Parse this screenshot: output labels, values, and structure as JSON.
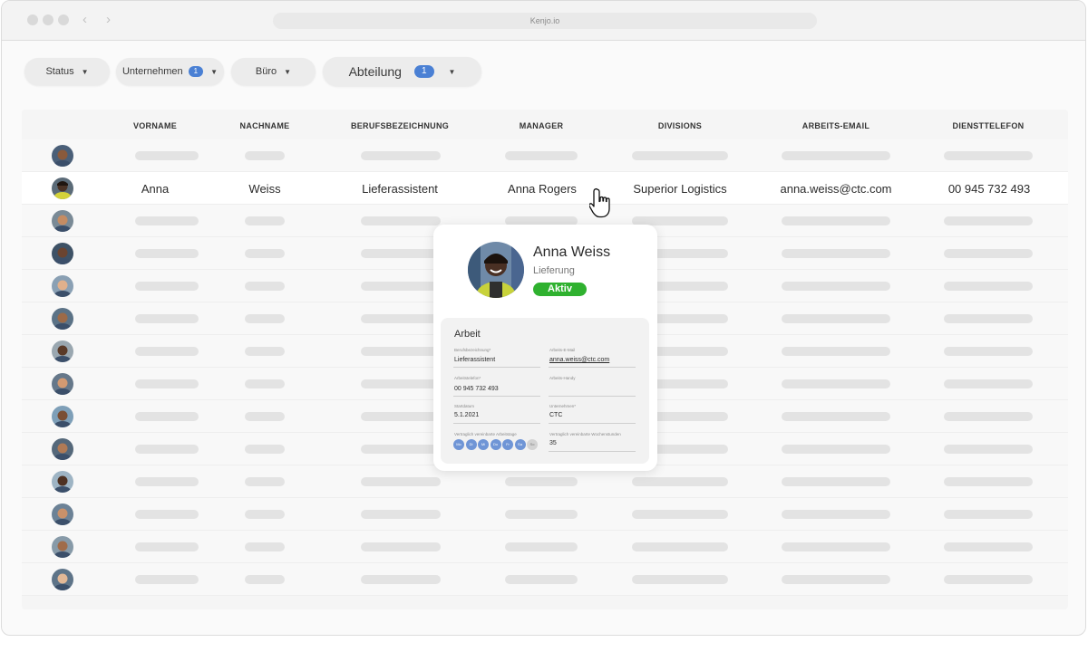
{
  "browser": {
    "url": "Kenjo.io"
  },
  "filters": [
    {
      "label": "Status",
      "count": null
    },
    {
      "label": "Unternehmen",
      "count": "1"
    },
    {
      "label": "Büro",
      "count": null
    },
    {
      "label": "Abteilung",
      "count": "1"
    }
  ],
  "table": {
    "columns": [
      "VORNAME",
      "NACHNAME",
      "BERUFSBEZEICHNUNG",
      "MANAGER",
      "DIVISIONS",
      "ARBEITS-EMAIL",
      "DIENSTTELEFON"
    ],
    "active_row": {
      "vorname": "Anna",
      "nachname": "Weiss",
      "berufsbezeichnung": "Lieferassistent",
      "manager": "Anna Rogers",
      "divisions": "Superior Logistics",
      "email": "anna.weiss@ctc.com",
      "telefon": "00 945 732 493"
    }
  },
  "profile": {
    "name": "Anna Weiss",
    "department": "Lieferung",
    "status": "Aktiv",
    "section_title": "Arbeit",
    "fields": {
      "job_title_label": "Berufsbezeichnung*",
      "job_title_value": "Lieferassistent",
      "work_email_label": "Arbeits-E-Mail",
      "work_email_value": "anna.weiss@ctc.com",
      "work_phone_label": "Arbeitstelefon*",
      "work_phone_value": "00 945 732 493",
      "work_mobile_label": "Arbeits-Handy",
      "work_mobile_value": "",
      "start_date_label": "Startdatum",
      "start_date_value": "5.1.2021",
      "company_label": "Unternehmen*",
      "company_value": "CTC",
      "contract_days_label": "Vertraglich vereinbarte Arbeitstage",
      "contract_hours_label": "Vertraglich vereinbarte Wochenstunden",
      "contract_hours_value": "35"
    },
    "workdays": [
      "Mo",
      "Di",
      "Mi",
      "Do",
      "Fr",
      "Sa",
      "So"
    ]
  },
  "colors": {
    "accent": "#4a80d4",
    "status_active": "#2fb12f",
    "skeleton": "#e3e3e3"
  }
}
